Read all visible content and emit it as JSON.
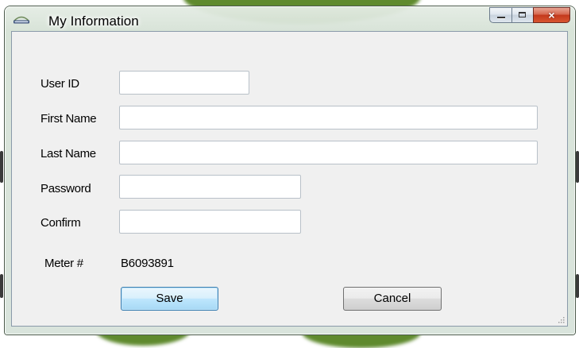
{
  "window": {
    "title": "My Information",
    "icon": "omnis-logo-icon",
    "controls": {
      "minimize": "minimize-icon",
      "maximize": "maximize-icon",
      "close": "×"
    }
  },
  "form": {
    "user_id": {
      "label": "User ID",
      "value": ""
    },
    "first_name": {
      "label": "First Name",
      "value": ""
    },
    "last_name": {
      "label": "Last Name",
      "value": ""
    },
    "password": {
      "label": "Password",
      "value": ""
    },
    "confirm": {
      "label": "Confirm",
      "value": ""
    },
    "meter": {
      "label": "Meter #",
      "value": "B6093891"
    }
  },
  "buttons": {
    "save": "Save",
    "cancel": "Cancel"
  },
  "colors": {
    "backdrop_green": "#5f8a2e",
    "client": "#f0f0f0",
    "close_red": "#c3391c",
    "default_button_border": "#3c7fb1"
  }
}
